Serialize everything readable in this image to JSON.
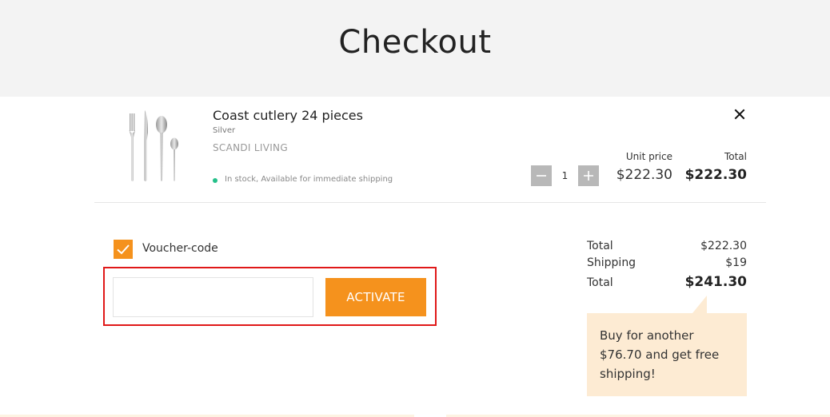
{
  "header": {
    "title": "Checkout"
  },
  "cart": {
    "item": {
      "name": "Coast cutlery 24 pieces",
      "variant": "Silver",
      "brand": "SCANDI LIVING",
      "stock": "In stock, Available for immediate shipping",
      "image_icon": "cutlery-image",
      "quantity": "1",
      "unit_price_label": "Unit price",
      "unit_price": "$222.30",
      "total_label": "Total",
      "total": "$222.30"
    }
  },
  "voucher": {
    "label": "Voucher-code",
    "checked": true,
    "input_value": "",
    "input_placeholder": "",
    "button_label": "ACTIVATE"
  },
  "summary": {
    "subtotal_label": "Total",
    "subtotal": "$222.30",
    "shipping_label": "Shipping",
    "shipping": "$19",
    "total_label": "Total",
    "total": "$241.30",
    "free_shipping_note": "Buy for another $76.70 and get free shipping!"
  },
  "colors": {
    "accent": "#f5921d",
    "in_stock": "#25c08a",
    "highlight": "#e01919",
    "note_background": "#fdebd3",
    "header_background": "#f3f3f3"
  }
}
